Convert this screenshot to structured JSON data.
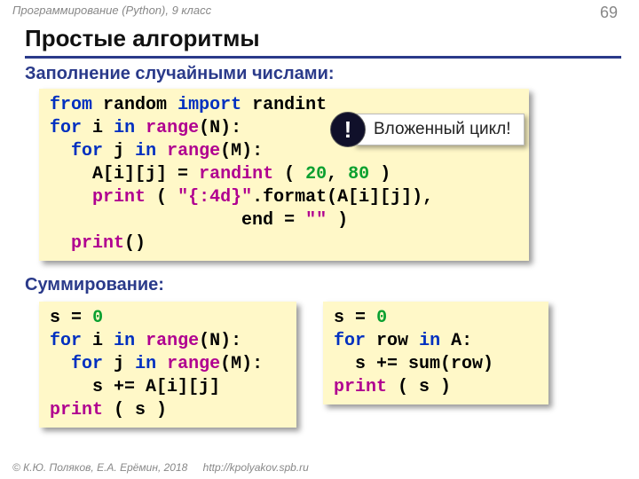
{
  "meta": {
    "course": "Программирование (Python), 9 класс",
    "page": "69",
    "title": "Простые алгоритмы",
    "footer_authors": "© К.Ю. Поляков, Е.А. Ерёмин, 2018",
    "footer_url": "http://kpolyakov.spb.ru"
  },
  "sections": {
    "fill_label": "Заполнение случайными числами:",
    "sum_label": "Суммирование:"
  },
  "callout": {
    "bang": "!",
    "text": "Вложенный цикл!"
  },
  "code1": {
    "t_from": "from",
    "t_random": "random",
    "t_import": "import",
    "t_randint": "randint",
    "t_for1": "for",
    "t_i": "i",
    "t_in1": "in",
    "t_range1": "range",
    "t_N": "(N):",
    "t_for2": "for",
    "t_j": "j",
    "t_in2": "in",
    "t_range2": "range",
    "t_M": "(M):",
    "t_assign": "A[i][j] =",
    "t_randcall": "randint",
    "t_paren_open": "(",
    "t_20": "20",
    "t_comma": ",",
    "t_80": "80",
    "t_paren_close": ")",
    "t_print1": "print",
    "t_fmtopen": "(",
    "t_fmtstr": "\"{:4d}\"",
    "t_fmtcall": ".format(A[i][j]),",
    "t_endkw": "end",
    "t_endeq": "=",
    "t_endval": "\"\"",
    "t_endclose": ")",
    "t_print2": "print",
    "t_print2p": "()"
  },
  "code2": {
    "l1_s": "s",
    "l1_eq": "=",
    "l1_0": "0",
    "l2_for": "for",
    "l2_i": "i",
    "l2_in": "in",
    "l2_range": "range",
    "l2_N": "(N):",
    "l3_for": "for",
    "l3_j": "j",
    "l3_in": "in",
    "l3_range": "range",
    "l3_M": "(M):",
    "l4": "s += A[i][j]",
    "l5_print": "print",
    "l5_rest": "( s )"
  },
  "code3": {
    "l1_s": "s",
    "l1_eq": "=",
    "l1_0": "0",
    "l2_for": "for",
    "l2_row": "row",
    "l2_in": "in",
    "l2_A": "A:",
    "l3": "s += sum(row)",
    "l4_print": "print",
    "l4_rest": "( s )"
  }
}
